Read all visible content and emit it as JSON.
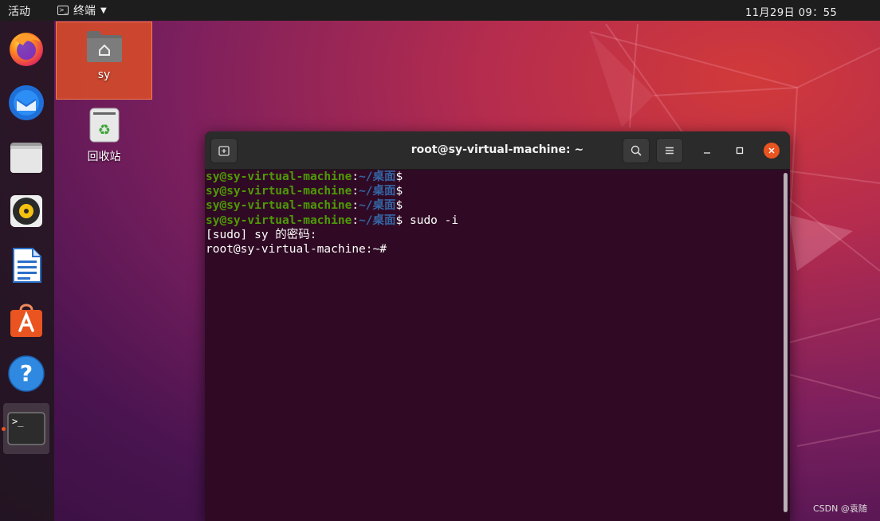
{
  "topbar": {
    "activities": "活动",
    "app_name": "终端",
    "clock": "11月29日  09：55"
  },
  "dock": {
    "items": [
      {
        "name": "Firefox",
        "icon": "firefox-icon"
      },
      {
        "name": "Thunderbird",
        "icon": "thunderbird-icon"
      },
      {
        "name": "Files",
        "icon": "files-icon"
      },
      {
        "name": "Rhythmbox",
        "icon": "rhythmbox-icon"
      },
      {
        "name": "LibreOffice Writer",
        "icon": "writer-icon"
      },
      {
        "name": "Ubuntu Software",
        "icon": "software-icon"
      },
      {
        "name": "Help",
        "icon": "help-icon"
      },
      {
        "name": "Terminal",
        "icon": "terminal-icon",
        "active": true
      }
    ]
  },
  "desktop": {
    "home_label": "sy",
    "trash_label": "回收站"
  },
  "terminal": {
    "title": "root@sy-virtual-machine: ~",
    "lines": [
      {
        "user": "sy@sy-virtual-machine",
        "sep": ":",
        "path": "~/桌面",
        "prompt": "$",
        "cmd": ""
      },
      {
        "user": "sy@sy-virtual-machine",
        "sep": ":",
        "path": "~/桌面",
        "prompt": "$",
        "cmd": ""
      },
      {
        "user": "sy@sy-virtual-machine",
        "sep": ":",
        "path": "~/桌面",
        "prompt": "$",
        "cmd": ""
      },
      {
        "user": "sy@sy-virtual-machine",
        "sep": ":",
        "path": "~/桌面",
        "prompt": "$",
        "cmd": " sudo -i"
      }
    ],
    "sudo_prompt": "[sudo] sy 的密码:",
    "root_prompt": "root@sy-virtual-machine:~#"
  },
  "watermark": "CSDN @袁随",
  "colors": {
    "accent": "#e95420",
    "terminal_bg": "#300a24",
    "prompt_user": "#4e9a06",
    "prompt_path": "#3465a4"
  }
}
